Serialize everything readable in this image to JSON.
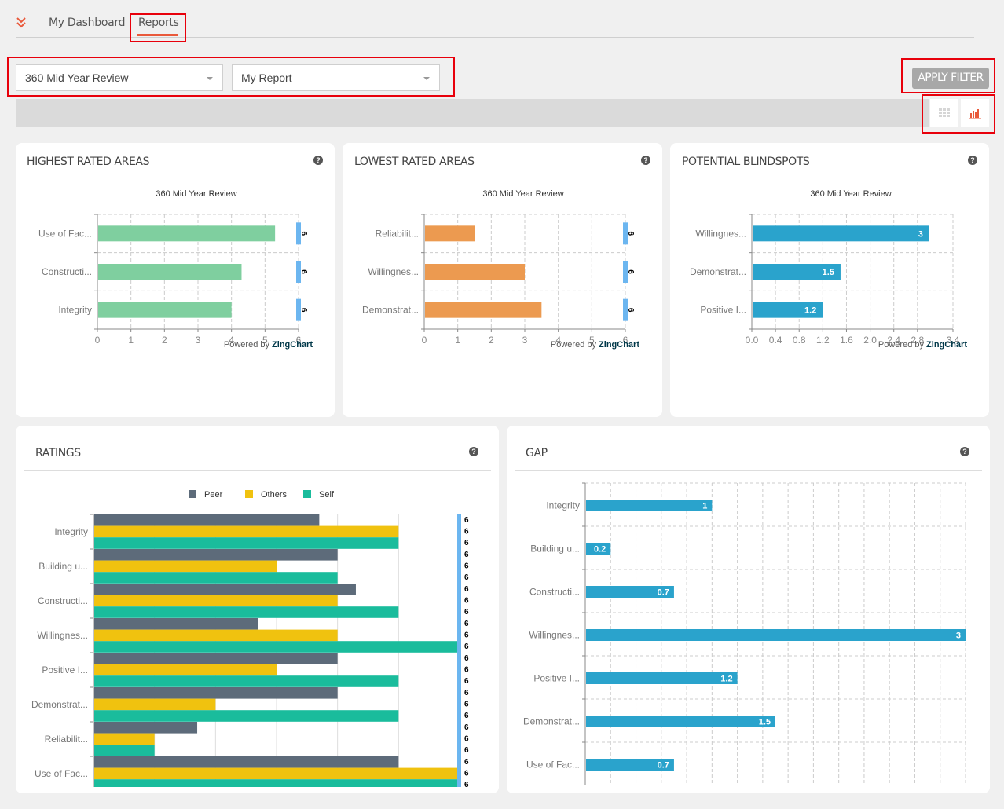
{
  "nav": {
    "tabs": [
      {
        "label": "My Dashboard",
        "active": false
      },
      {
        "label": "Reports",
        "active": true
      }
    ]
  },
  "filters": {
    "review_select": {
      "value": "360 Mid Year Review"
    },
    "report_select": {
      "value": "My Report"
    },
    "apply_label": "APPLY FILTER"
  },
  "view_toggle": {
    "items": [
      {
        "icon": "table-icon",
        "active": false
      },
      {
        "icon": "bar-chart-icon",
        "active": true
      }
    ]
  },
  "colors": {
    "accent": "#e9593b",
    "highest_bar": "#7fcf9f",
    "lowest_bar": "#ec9a50",
    "blindspot_bar": "#2aa3cc",
    "peer": "#5d6b7a",
    "others": "#f0c20f",
    "self": "#1abc9c",
    "marker": "#6cb6f0"
  },
  "cards": {
    "highest": {
      "title": "HIGHEST RATED AREAS",
      "help": "?"
    },
    "lowest": {
      "title": "LOWEST RATED AREAS",
      "help": "?"
    },
    "blindspots": {
      "title": "POTENTIAL BLINDSPOTS",
      "help": "?"
    },
    "ratings": {
      "title": "RATINGS",
      "help": "?"
    },
    "gap": {
      "title": "GAP",
      "help": "?"
    }
  },
  "powered_by": {
    "prefix": "Powered by ",
    "brand": "ZingChart"
  },
  "chart_data": [
    {
      "id": "highest",
      "type": "bar",
      "orientation": "horizontal",
      "title": "360 Mid Year Review",
      "categories": [
        "Use of Fac...",
        "Constructi...",
        "Integrity"
      ],
      "values": [
        5.3,
        4.3,
        4.0
      ],
      "marker_labels": [
        "6",
        "6",
        "6"
      ],
      "xlim": [
        0,
        6
      ],
      "xticks": [
        "0",
        "1",
        "2",
        "3",
        "4",
        "5",
        "6"
      ],
      "grid": true
    },
    {
      "id": "lowest",
      "type": "bar",
      "orientation": "horizontal",
      "title": "360 Mid Year Review",
      "categories": [
        "Reliabilit...",
        "Willingnes...",
        "Demonstrat..."
      ],
      "values": [
        1.5,
        3.0,
        3.5
      ],
      "marker_labels": [
        "6",
        "6",
        "6"
      ],
      "xlim": [
        0,
        6
      ],
      "xticks": [
        "0",
        "1",
        "2",
        "3",
        "4",
        "5",
        "6"
      ],
      "grid": true
    },
    {
      "id": "blindspots",
      "type": "bar",
      "orientation": "horizontal",
      "title": "360 Mid Year Review",
      "categories": [
        "Willingnes...",
        "Demonstrat...",
        "Positive I..."
      ],
      "values": [
        3,
        1.5,
        1.2
      ],
      "value_labels": [
        "3",
        "1.5",
        "1.2"
      ],
      "xlim": [
        0,
        3.4
      ],
      "xticks": [
        "0.0",
        "0.4",
        "0.8",
        "1.2",
        "1.6",
        "2.0",
        "2.4",
        "2.8",
        "3.4"
      ],
      "grid": true
    },
    {
      "id": "ratings",
      "type": "bar",
      "orientation": "horizontal",
      "title": "",
      "legend": [
        "Peer",
        "Others",
        "Self"
      ],
      "legend_position": "top-center",
      "categories": [
        "Integrity",
        "Building u...",
        "Constructi...",
        "Willingnes...",
        "Positive I...",
        "Demonstrat...",
        "Reliabilit...",
        "Use of Fac..."
      ],
      "series": [
        {
          "name": "Peer",
          "values": [
            3.7,
            4,
            4.3,
            2.7,
            4,
            4,
            1.7,
            5
          ]
        },
        {
          "name": "Others",
          "values": [
            5,
            3,
            4,
            4,
            3,
            2,
            1,
            6
          ]
        },
        {
          "name": "Self",
          "values": [
            5,
            4,
            5,
            6,
            5,
            5,
            1,
            6
          ]
        }
      ],
      "marker_label": "6",
      "xlim": [
        0,
        6
      ],
      "grid": true
    },
    {
      "id": "gap",
      "type": "bar",
      "orientation": "horizontal",
      "title": "",
      "categories": [
        "Integrity",
        "Building u...",
        "Constructi...",
        "Willingnes...",
        "Positive I...",
        "Demonstrat...",
        "Use of Fac..."
      ],
      "values": [
        1,
        0.2,
        0.7,
        3,
        1.2,
        1.5,
        0.7
      ],
      "value_labels": [
        "1",
        "0.2",
        "0.7",
        "3",
        "1.2",
        "1.5",
        "0.7"
      ],
      "xlim": [
        0,
        3
      ],
      "grid": true
    }
  ]
}
